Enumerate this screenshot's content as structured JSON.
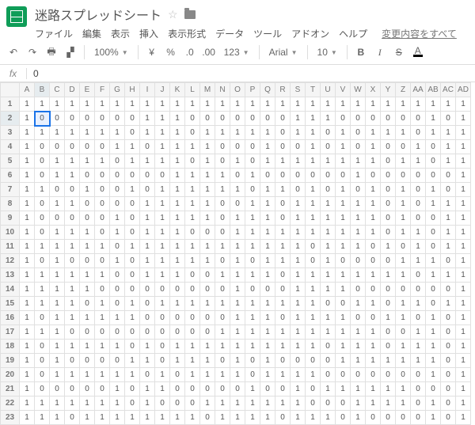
{
  "title": "迷路スプレッドシート",
  "menus": [
    "ファイル",
    "編集",
    "表示",
    "挿入",
    "表示形式",
    "データ",
    "ツール",
    "アドオン",
    "ヘルプ"
  ],
  "changes_text": "変更内容をすべて",
  "toolbar": {
    "zoom": "100%",
    "currency": "¥",
    "percent": "%",
    "dec_less": ".0",
    "dec_more": ".00",
    "num_fmt": "123",
    "font": "Arial",
    "font_size": "10",
    "bold": "B",
    "italic": "I",
    "strike": "S",
    "color": "A"
  },
  "formula": {
    "fx": "fx",
    "value": "0"
  },
  "selection": {
    "row": 2,
    "col": 1
  },
  "columns": [
    "A",
    "B",
    "C",
    "D",
    "E",
    "F",
    "G",
    "H",
    "I",
    "J",
    "K",
    "L",
    "M",
    "N",
    "O",
    "P",
    "Q",
    "R",
    "S",
    "T",
    "U",
    "V",
    "W",
    "X",
    "Y",
    "Z",
    "AA",
    "AB",
    "AC",
    "AD"
  ],
  "rows": [
    [
      1,
      1,
      1,
      1,
      1,
      1,
      1,
      1,
      1,
      1,
      1,
      1,
      1,
      1,
      1,
      1,
      1,
      1,
      1,
      1,
      1,
      1,
      1,
      1,
      1,
      1,
      1,
      1,
      1,
      1
    ],
    [
      1,
      0,
      0,
      0,
      0,
      0,
      0,
      0,
      1,
      1,
      1,
      0,
      0,
      0,
      0,
      0,
      0,
      0,
      1,
      1,
      1,
      0,
      0,
      0,
      0,
      0,
      0,
      1,
      0,
      1
    ],
    [
      1,
      1,
      1,
      1,
      1,
      1,
      1,
      0,
      1,
      1,
      1,
      0,
      1,
      1,
      1,
      1,
      1,
      0,
      1,
      1,
      0,
      1,
      0,
      1,
      1,
      1,
      0,
      1,
      1,
      1
    ],
    [
      1,
      0,
      0,
      0,
      0,
      0,
      1,
      1,
      0,
      1,
      1,
      1,
      1,
      0,
      0,
      0,
      1,
      0,
      0,
      1,
      0,
      1,
      0,
      1,
      0,
      0,
      1,
      0,
      1,
      1
    ],
    [
      1,
      0,
      1,
      1,
      1,
      1,
      0,
      1,
      1,
      1,
      1,
      0,
      1,
      0,
      1,
      0,
      1,
      1,
      1,
      1,
      1,
      1,
      1,
      1,
      0,
      1,
      1,
      0,
      1,
      1
    ],
    [
      1,
      0,
      1,
      1,
      0,
      0,
      0,
      0,
      0,
      0,
      1,
      1,
      1,
      1,
      0,
      1,
      0,
      0,
      0,
      0,
      0,
      0,
      1,
      0,
      0,
      0,
      0,
      0,
      0,
      1
    ],
    [
      1,
      1,
      0,
      0,
      1,
      0,
      0,
      1,
      0,
      1,
      1,
      1,
      1,
      1,
      1,
      0,
      1,
      1,
      0,
      1,
      0,
      1,
      0,
      1,
      0,
      1,
      0,
      1,
      0,
      1
    ],
    [
      1,
      0,
      1,
      1,
      0,
      0,
      0,
      0,
      1,
      1,
      1,
      1,
      1,
      0,
      0,
      1,
      1,
      0,
      1,
      1,
      1,
      1,
      1,
      1,
      0,
      1,
      0,
      1,
      1,
      1
    ],
    [
      1,
      0,
      0,
      0,
      0,
      0,
      1,
      0,
      1,
      1,
      1,
      1,
      1,
      0,
      1,
      1,
      1,
      0,
      1,
      1,
      1,
      1,
      1,
      1,
      0,
      1,
      0,
      0,
      1,
      1
    ],
    [
      1,
      0,
      1,
      1,
      1,
      0,
      1,
      0,
      1,
      1,
      1,
      0,
      0,
      0,
      1,
      1,
      1,
      1,
      1,
      1,
      1,
      1,
      1,
      1,
      0,
      1,
      1,
      0,
      1,
      1
    ],
    [
      1,
      1,
      1,
      1,
      1,
      1,
      0,
      1,
      1,
      1,
      1,
      1,
      1,
      1,
      1,
      1,
      1,
      1,
      1,
      0,
      1,
      1,
      1,
      0,
      1,
      0,
      1,
      0,
      1,
      1
    ],
    [
      1,
      0,
      1,
      0,
      0,
      0,
      1,
      0,
      1,
      1,
      1,
      1,
      1,
      0,
      1,
      0,
      1,
      1,
      1,
      0,
      1,
      0,
      0,
      0,
      0,
      1,
      1,
      1,
      0,
      1
    ],
    [
      1,
      1,
      1,
      1,
      1,
      1,
      0,
      0,
      1,
      1,
      1,
      0,
      0,
      1,
      1,
      1,
      1,
      0,
      1,
      1,
      1,
      1,
      1,
      1,
      1,
      1,
      0,
      1,
      1,
      1
    ],
    [
      1,
      1,
      1,
      1,
      1,
      0,
      0,
      0,
      0,
      0,
      0,
      0,
      0,
      0,
      1,
      0,
      0,
      0,
      1,
      1,
      1,
      1,
      0,
      0,
      0,
      0,
      0,
      0,
      0,
      1
    ],
    [
      1,
      1,
      1,
      1,
      0,
      1,
      0,
      1,
      0,
      1,
      1,
      1,
      1,
      1,
      1,
      1,
      1,
      1,
      1,
      1,
      0,
      0,
      1,
      1,
      0,
      1,
      1,
      0,
      1,
      1
    ],
    [
      1,
      0,
      1,
      1,
      1,
      1,
      1,
      1,
      0,
      0,
      0,
      0,
      0,
      0,
      1,
      1,
      1,
      0,
      1,
      1,
      1,
      1,
      0,
      0,
      1,
      1,
      0,
      1,
      0,
      1
    ],
    [
      1,
      1,
      1,
      0,
      0,
      0,
      0,
      0,
      0,
      0,
      0,
      0,
      0,
      1,
      1,
      1,
      1,
      1,
      1,
      1,
      1,
      1,
      1,
      1,
      0,
      0,
      1,
      1,
      0,
      1
    ],
    [
      1,
      0,
      1,
      1,
      1,
      1,
      1,
      0,
      1,
      0,
      1,
      1,
      1,
      1,
      1,
      1,
      1,
      1,
      1,
      1,
      0,
      1,
      1,
      1,
      0,
      1,
      1,
      1,
      0,
      1
    ],
    [
      1,
      0,
      1,
      0,
      0,
      0,
      0,
      1,
      1,
      0,
      1,
      1,
      1,
      0,
      1,
      0,
      1,
      0,
      0,
      0,
      0,
      1,
      1,
      1,
      1,
      1,
      1,
      1,
      0,
      1
    ],
    [
      1,
      0,
      1,
      1,
      1,
      1,
      1,
      1,
      0,
      1,
      0,
      1,
      1,
      1,
      1,
      0,
      1,
      1,
      1,
      1,
      0,
      0,
      0,
      0,
      0,
      0,
      0,
      1,
      0,
      1
    ],
    [
      1,
      0,
      0,
      0,
      0,
      0,
      1,
      0,
      1,
      1,
      0,
      0,
      0,
      0,
      0,
      1,
      0,
      0,
      1,
      0,
      1,
      1,
      1,
      1,
      1,
      1,
      0,
      0,
      0,
      1
    ],
    [
      1,
      1,
      1,
      1,
      1,
      1,
      1,
      0,
      1,
      0,
      0,
      0,
      1,
      1,
      1,
      1,
      1,
      1,
      1,
      0,
      0,
      0,
      1,
      1,
      1,
      1,
      0,
      1,
      0,
      1
    ],
    [
      1,
      1,
      1,
      0,
      1,
      1,
      1,
      1,
      1,
      1,
      1,
      1,
      0,
      1,
      1,
      1,
      1,
      0,
      1,
      1,
      1,
      0,
      1,
      0,
      0,
      0,
      0,
      1,
      0,
      1
    ]
  ]
}
